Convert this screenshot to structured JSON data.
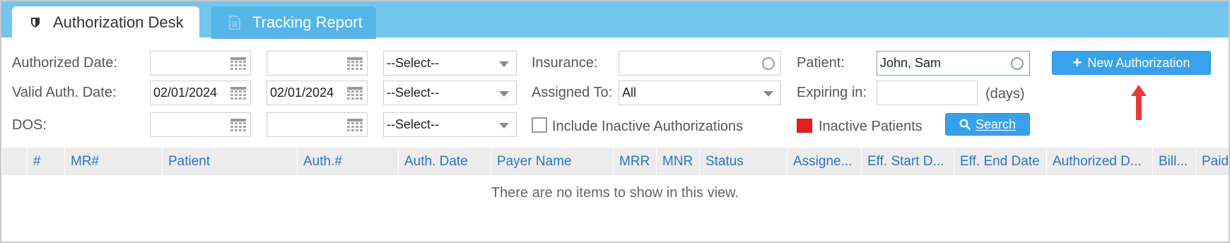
{
  "tabs": [
    {
      "label": "Authorization Desk",
      "icon": "shield-icon",
      "active": true
    },
    {
      "label": "Tracking Report",
      "icon": "document-icon",
      "active": false
    }
  ],
  "filters": {
    "authorized_date_label": "Authorized Date:",
    "valid_auth_date_label": "Valid Auth. Date:",
    "dos_label": "DOS:",
    "authorized_from": "",
    "authorized_to": "",
    "valid_from": "02/01/2024",
    "valid_to": "02/01/2024",
    "dos_from": "",
    "dos_to": "",
    "select_placeholder": "--Select--",
    "insurance_label": "Insurance:",
    "insurance_value": "",
    "assigned_to_label": "Assigned To:",
    "assigned_to_value": "All",
    "include_inactive_label": "Include Inactive Authorizations",
    "patient_label": "Patient:",
    "patient_value": "John, Sam",
    "expiring_label": "Expiring in:",
    "expiring_value": "",
    "days_label": "(days)",
    "inactive_patients_label": "Inactive Patients",
    "inactive_patients_color": "#e41d1d"
  },
  "buttons": {
    "new_authorization": "New Authorization",
    "search": "Search"
  },
  "grid": {
    "columns": [
      "#",
      "MR#",
      "Patient",
      "Auth.#",
      "Auth. Date",
      "Payer Name",
      "MRR",
      "MNR",
      "Status",
      "Assigne...",
      "Eff. Start D...",
      "Eff. End Date",
      "Authorized D...",
      "Bill...",
      "Paid"
    ],
    "empty_message": "There are no items to show in this view."
  },
  "colors": {
    "tabbar": "#72c5ec",
    "accent": "#37a2eb",
    "header_text": "#2b73c6",
    "arrow": "#e8393a"
  }
}
